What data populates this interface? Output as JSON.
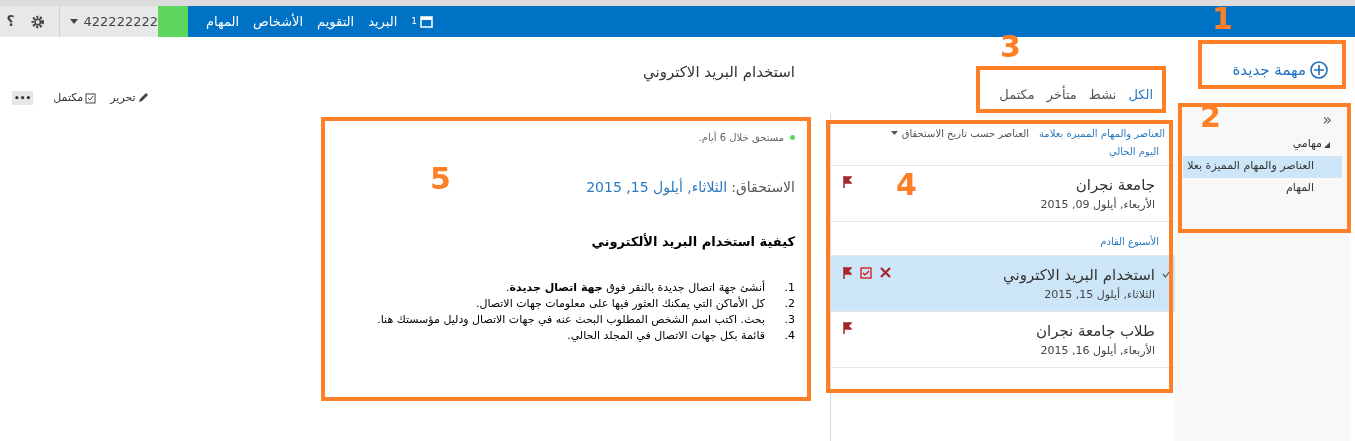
{
  "top_bar": {
    "help": "؟",
    "account": "422222222",
    "nav": [
      {
        "label": "البريد"
      },
      {
        "label": "التقويم"
      },
      {
        "label": "الأشخاص"
      },
      {
        "label": "المهام"
      }
    ],
    "calendar_badge": "1"
  },
  "reading_pane": {
    "title": "استخدام البريد الاكتروني",
    "toolbar": [
      {
        "kind": "edit",
        "label": "تحرير"
      },
      {
        "kind": "complete",
        "label": "مكتمل"
      },
      {
        "kind": "more",
        "label": "•••"
      }
    ],
    "due_note": "مستحق خلال 6 أيام.",
    "due_label": "الاستحقاق:",
    "due_date": "الثلاثاء, أيلول 15, 2015",
    "heading": "كيفية استخدام البريد الألكتروني",
    "steps": [
      {
        "number": "1.",
        "text": "أنشئ جهة اتصال جديدة بالنقر فوق **جهة اتصال جديدة**."
      },
      {
        "number": "2.",
        "text": "كل الأماكن التي يمكنك العثور فيها على معلومات جهات الاتصال."
      },
      {
        "number": "3.",
        "text": "بحث. اكتب اسم الشخص المطلوب البحث عنه في جهات الاتصال ودليل مؤسستك هنا."
      },
      {
        "number": "4.",
        "text": "قائمة بكل جهات الاتصال في المجلد الحالي."
      }
    ]
  },
  "filter_tabs": [
    {
      "label": "الكل",
      "selected": true
    },
    {
      "label": "نشط",
      "selected": false
    },
    {
      "label": "متأخر",
      "selected": false
    },
    {
      "label": "مكتمل",
      "selected": false
    }
  ],
  "task_list": {
    "header": "العناصر والمهام المميزة بعلامة",
    "sort": "العناصر حسب تاريخ الاستحقاق",
    "groups": [
      {
        "label": "اليوم الحالي",
        "tasks": [
          {
            "title": "جامعة نجران",
            "date": "الأربعاء, أيلول 09, 2015",
            "selected": false
          }
        ]
      },
      {
        "label": "الأسبوع القادم",
        "tasks": [
          {
            "title": "استخدام البريد الاكتروني",
            "date": "الثلاثاء, أيلول 15, 2015",
            "selected": true
          },
          {
            "title": "طلاب جامعة نجران",
            "date": "الأربعاء, أيلول 16, 2015",
            "selected": false
          }
        ]
      }
    ]
  },
  "new_task": "مهمة جديدة",
  "folders": {
    "collapse": "«",
    "items": [
      {
        "label": "مهامي",
        "kind": "group",
        "selected": false
      },
      {
        "label": "العناصر والمهام المميزة بعلا",
        "kind": "folder",
        "selected": true
      },
      {
        "label": "المهام",
        "kind": "folder",
        "selected": false
      }
    ]
  },
  "annotations": [
    {
      "label": "1"
    },
    {
      "label": "2"
    },
    {
      "label": "3"
    },
    {
      "label": "4"
    },
    {
      "label": "5"
    }
  ]
}
